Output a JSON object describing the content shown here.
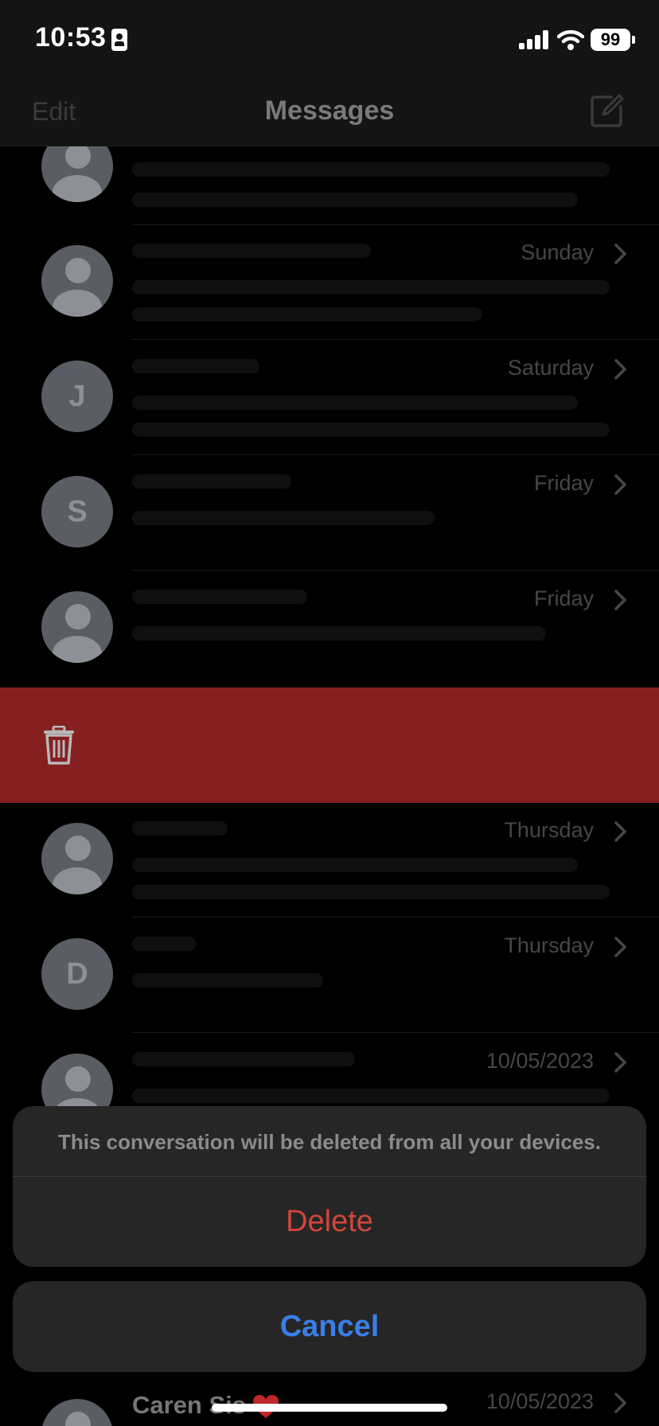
{
  "status_bar": {
    "time": "10:53",
    "battery": "99"
  },
  "nav": {
    "edit_label": "Edit",
    "title": "Messages"
  },
  "conversations": [
    {
      "date": "",
      "avatar": "person",
      "name": "",
      "preview": ""
    },
    {
      "date": "Sunday",
      "avatar": "person"
    },
    {
      "date": "Saturday",
      "avatar": "letter",
      "initial": "J"
    },
    {
      "date": "Friday",
      "avatar": "letter",
      "initial": "S"
    },
    {
      "date": "Friday",
      "avatar": "person"
    },
    {
      "date": "Thursday",
      "avatar": "person"
    },
    {
      "date": "Thursday",
      "avatar": "letter",
      "initial": "D"
    },
    {
      "date": "10/05/2023",
      "avatar": "person"
    }
  ],
  "action_sheet": {
    "message": "This conversation will be deleted from all your devices.",
    "delete_label": "Delete",
    "cancel_label": "Cancel"
  },
  "bottom_row": {
    "name": "Caren Sis",
    "date": "10/05/2023"
  },
  "colors": {
    "delete_red": "#d1453b",
    "cancel_blue": "#3a7fe8",
    "swipe_red": "#861f1f"
  }
}
